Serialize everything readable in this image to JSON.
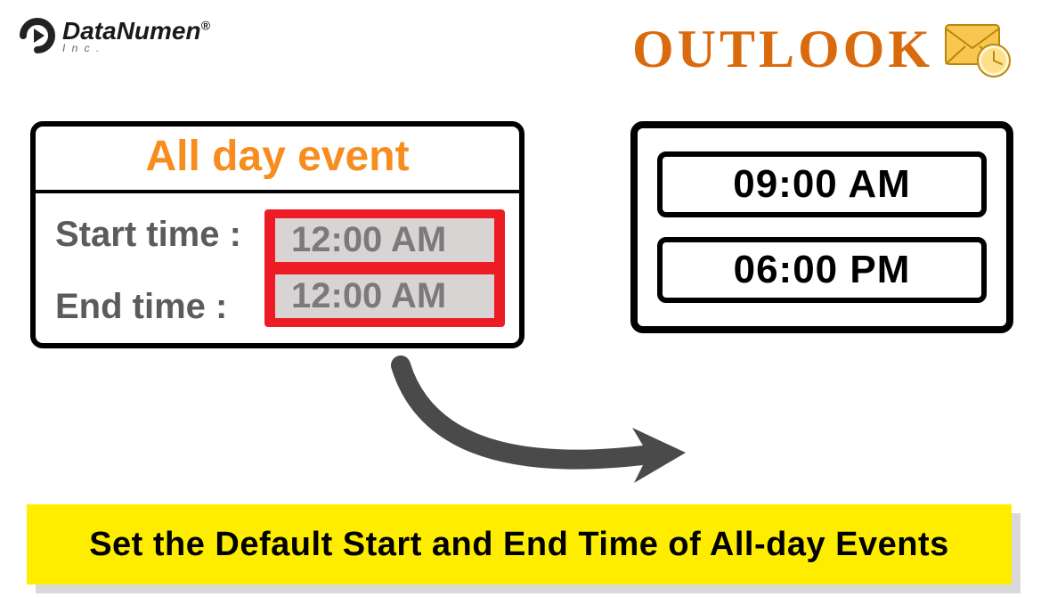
{
  "logo": {
    "brand_bold": "Data",
    "brand_rest": "Numen",
    "registered": "®",
    "sub": "I n c ."
  },
  "outlook": {
    "title": "OUTLOOK"
  },
  "left_panel": {
    "title": "All day event",
    "start_label": "Start time :",
    "end_label": "End time :",
    "start_value": "12:00 AM",
    "end_value": "12:00 AM"
  },
  "right_panel": {
    "start_value": "09:00 AM",
    "end_value": "06:00 PM"
  },
  "banner": {
    "text": "Set the Default Start and End Time of All-day Events"
  }
}
